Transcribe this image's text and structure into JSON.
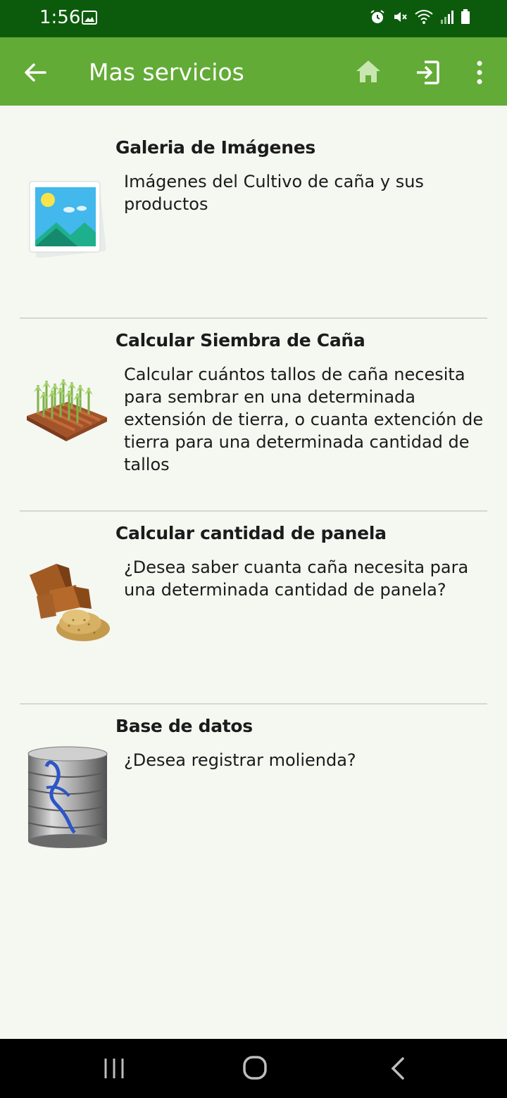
{
  "status_bar": {
    "time": "1:56"
  },
  "app_bar": {
    "title": "Mas servicios"
  },
  "items": [
    {
      "title": "Galeria de Imágenes",
      "description": "Imágenes del Cultivo de caña y sus productos",
      "icon": "gallery-icon"
    },
    {
      "title": "Calcular Siembra de Caña",
      "description": "Calcular cuántos tallos de caña necesita para sembrar en una determinada extensión de tierra, o cuanta extención de tierra para una determinada cantidad de tallos",
      "icon": "sugarcane-field-icon"
    },
    {
      "title": "Calcular cantidad de panela",
      "description": "¿Desea saber cuanta caña necesita para una determinada cantidad de panela?",
      "icon": "panela-icon"
    },
    {
      "title": "Base de datos",
      "description": "¿Desea registrar molienda?",
      "icon": "database-icon"
    }
  ],
  "colors": {
    "status_bar": "#0c5b0c",
    "app_bar": "#62ab36",
    "background": "#f5f7f1"
  }
}
